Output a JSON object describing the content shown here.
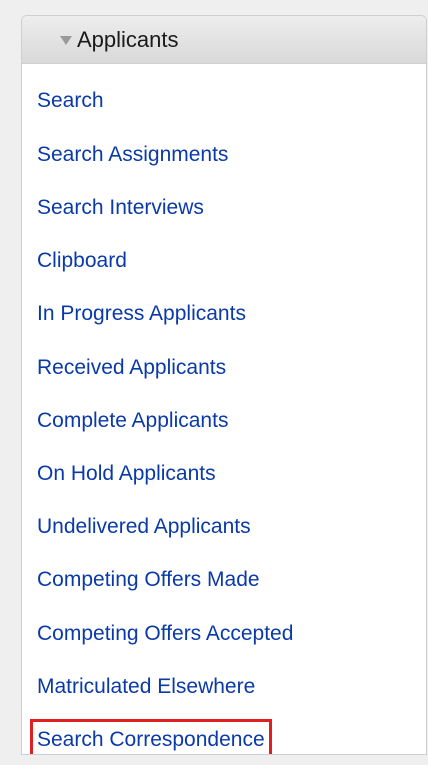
{
  "panel": {
    "title": "Applicants",
    "items": [
      {
        "label": "Search"
      },
      {
        "label": "Search Assignments"
      },
      {
        "label": "Search Interviews"
      },
      {
        "label": "Clipboard"
      },
      {
        "label": "In Progress Applicants"
      },
      {
        "label": "Received Applicants"
      },
      {
        "label": "Complete Applicants"
      },
      {
        "label": "On Hold Applicants"
      },
      {
        "label": "Undelivered Applicants"
      },
      {
        "label": "Competing Offers Made"
      },
      {
        "label": "Competing Offers Accepted"
      },
      {
        "label": "Matriculated Elsewhere"
      },
      {
        "label": "Search Correspondence"
      }
    ]
  },
  "colors": {
    "link": "#0a3aa8",
    "highlight_box": "#e02020",
    "header_bg": "#e3e3e3"
  },
  "icons": {
    "collapse": "triangle-down-icon"
  }
}
